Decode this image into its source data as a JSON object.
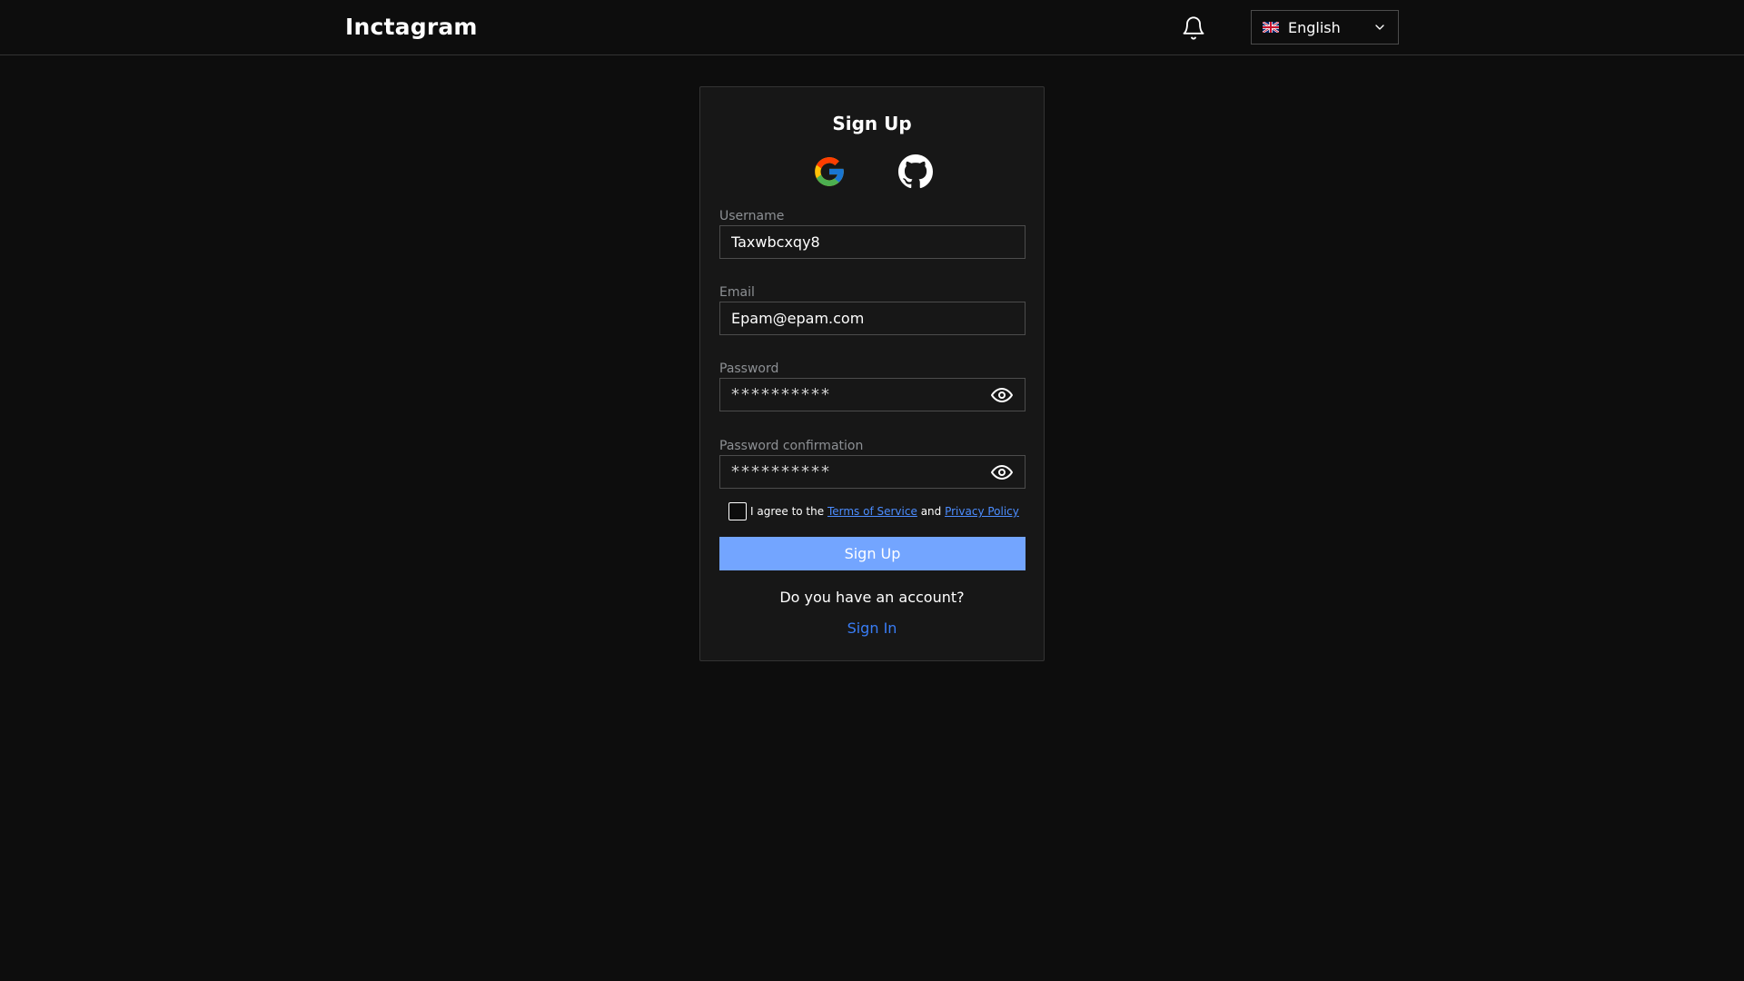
{
  "header": {
    "logo": "Inctagram",
    "language": {
      "selected": "English",
      "flag_icon": "uk-flag-icon"
    },
    "notification_icon": "bell-icon"
  },
  "signup": {
    "title": "Sign Up",
    "oauth": {
      "google_icon": "google-icon",
      "github_icon": "github-icon"
    },
    "username": {
      "label": "Username",
      "value": "Taxwbcxqy8"
    },
    "email": {
      "label": "Email",
      "value": "Epam@epam.com"
    },
    "password": {
      "label": "Password",
      "value": "**********",
      "toggle_icon": "eye-icon"
    },
    "password_confirmation": {
      "label": "Password confirmation",
      "value": "**********",
      "toggle_icon": "eye-icon"
    },
    "agree": {
      "prefix": "I agree to the",
      "terms": "Terms of Service",
      "conjunction": "and",
      "privacy": "Privacy Policy",
      "checked": false
    },
    "submit_label": "Sign Up",
    "have_account": "Do you have an account?",
    "signin_label": "Sign In"
  },
  "colors": {
    "background": "#0d0d0d",
    "card": "#171717",
    "border": "#333333",
    "primary_button": "#73a5ff",
    "link": "#397df6"
  }
}
